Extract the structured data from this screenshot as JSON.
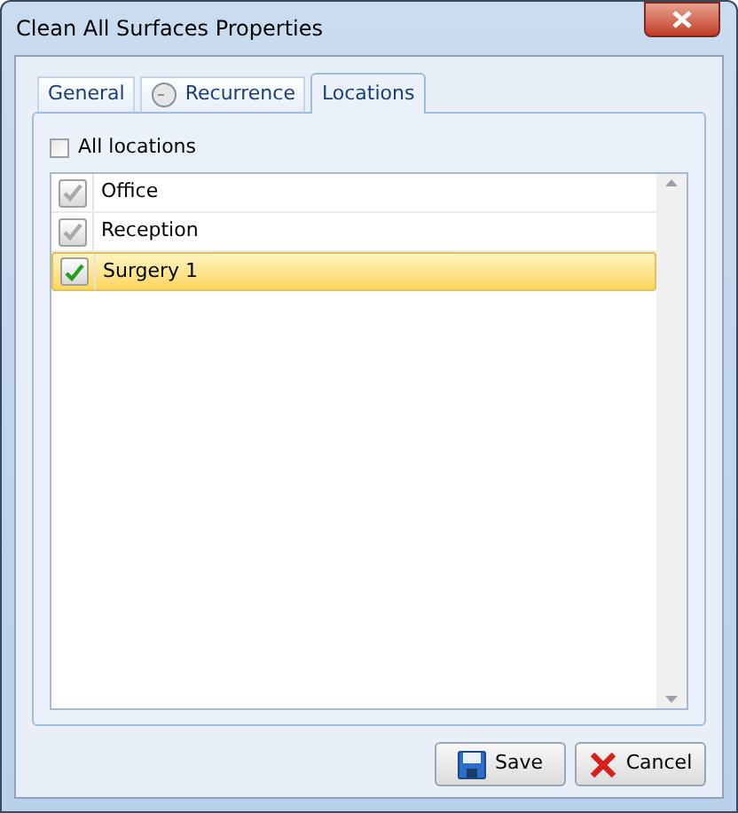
{
  "window": {
    "title": "Clean All Surfaces Properties"
  },
  "tabs": [
    {
      "label": "General",
      "selected": false,
      "kind": "plain"
    },
    {
      "label": "Recurrence",
      "selected": false,
      "kind": "clock"
    },
    {
      "label": "Locations",
      "selected": true,
      "kind": "plain"
    }
  ],
  "all_locations": {
    "label": "All locations",
    "checked": false
  },
  "locations": [
    {
      "name": "Office",
      "checked": false,
      "selected": false
    },
    {
      "name": "Reception",
      "checked": false,
      "selected": false
    },
    {
      "name": "Surgery 1",
      "checked": true,
      "selected": true
    }
  ],
  "buttons": [
    {
      "label": "Save",
      "kind": "save"
    },
    {
      "label": "Cancel",
      "kind": "cancel"
    }
  ]
}
